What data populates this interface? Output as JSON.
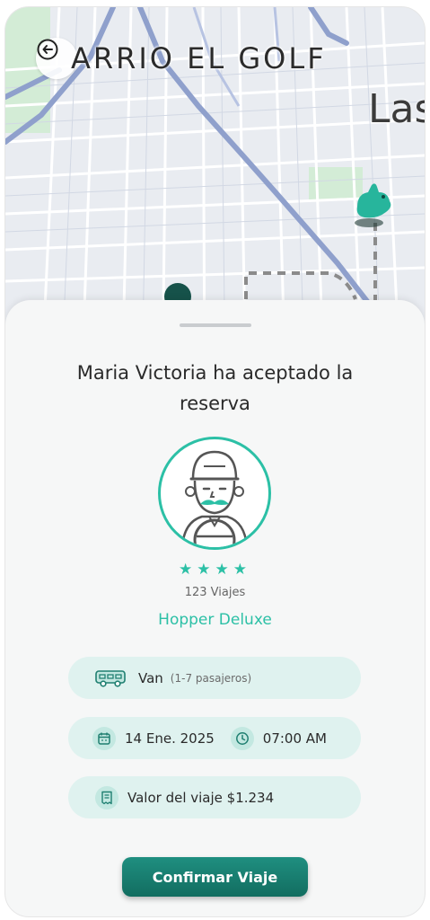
{
  "map": {
    "neighborhood_label": "ARRIO EL GOLF",
    "district_label": "Las",
    "back_icon": "arrow-left-circle-icon",
    "car_marker_icon": "rabbit-car-icon"
  },
  "booking": {
    "title": "Maria Victoria ha aceptado la reserva",
    "rating_stars": "★★★★",
    "rating_value": 4,
    "trips": "123 Viajes",
    "vehicle_class": "Hopper Deluxe"
  },
  "details": {
    "vehicle_type": "Van",
    "capacity": "(1-7 pasajeros)",
    "date": "14 Ene. 2025",
    "time": "07:00 AM",
    "price": "Valor del viaje $1.234"
  },
  "actions": {
    "confirm_label": "Confirmar Viaje"
  },
  "colors": {
    "accent": "#2cc0a6",
    "button": "#167a6c",
    "pill_bg": "#dff2ef",
    "map_road_major": "#8a9bc9",
    "map_park": "#cfe9d3"
  }
}
